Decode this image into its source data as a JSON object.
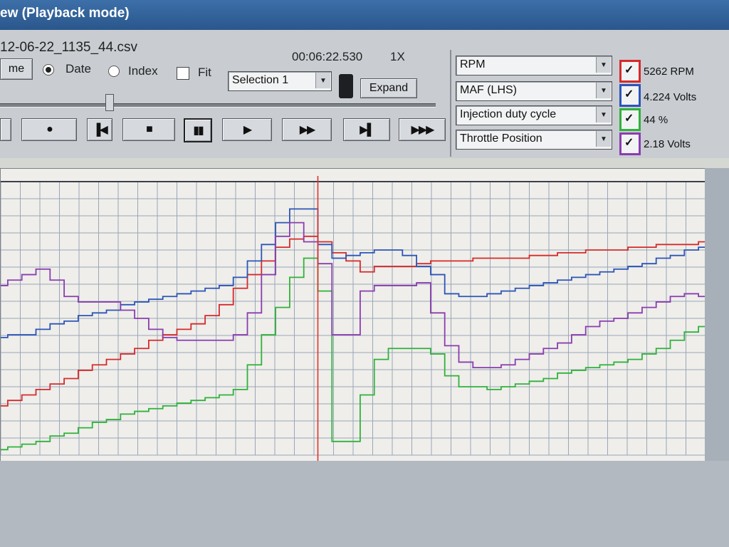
{
  "window": {
    "title": "ew (Playback mode)"
  },
  "toolbar": {
    "filename": "12-06-22_1135_44.csv",
    "timecode": "00:06:22.530",
    "speed": "1X",
    "time_button_label": "me",
    "radio_date_label": "Date",
    "radio_index_label": "Index",
    "fit_label": "Fit",
    "selection_value": "Selection 1",
    "expand_label": "Expand",
    "slider_position": 0.25
  },
  "channels": [
    {
      "param": "RPM",
      "readout": "5262 RPM",
      "color": "#d62a2a",
      "checked": true
    },
    {
      "param": "MAF (LHS)",
      "readout": "4.224 Volts",
      "color": "#2c55b8",
      "checked": true
    },
    {
      "param": "Injection duty cycle",
      "readout": "44 %",
      "color": "#2fb23a",
      "checked": true
    },
    {
      "param": "Throttle Position",
      "readout": "2.18 Volts",
      "color": "#8a3db0",
      "checked": true
    }
  ],
  "playback_icons": [
    "skip-start-icon",
    "record-icon",
    "step-back-icon",
    "stop-icon",
    "pause-icon",
    "play-icon",
    "fast-forward-icon",
    "step-forward-icon",
    "fastest-forward-icon"
  ],
  "chart_data": {
    "type": "line",
    "x": [
      0,
      2,
      4,
      6,
      8,
      10,
      12,
      14,
      16,
      18,
      20,
      22,
      24,
      26,
      28,
      30,
      32,
      34,
      36,
      38,
      40,
      42,
      44,
      46,
      48,
      50,
      52,
      54,
      56,
      58,
      60,
      62,
      64,
      66,
      68,
      70,
      72,
      74,
      76,
      78,
      80,
      82,
      84,
      86,
      88,
      90,
      92,
      94,
      96,
      98,
      100
    ],
    "xlim": [
      0,
      100
    ],
    "ylim": [
      0,
      100
    ],
    "cursor_x": 45,
    "grid": true,
    "series": [
      {
        "color": "#d62a2a",
        "values": [
          18,
          20,
          22,
          24,
          26,
          28,
          31,
          33,
          35,
          37,
          39,
          42,
          44,
          46,
          48,
          51,
          55,
          61,
          66,
          71,
          76,
          79,
          80,
          78,
          74,
          71,
          67,
          69,
          69,
          69,
          70,
          71,
          71,
          71,
          72,
          72,
          72,
          72,
          73,
          73,
          74,
          74,
          75,
          75,
          75,
          76,
          76,
          77,
          77,
          77,
          78
        ]
      },
      {
        "color": "#2c55b8",
        "values": [
          43,
          44,
          44,
          46,
          48,
          49,
          51,
          52,
          53,
          55,
          56,
          57,
          58,
          59,
          60,
          61,
          62,
          65,
          71,
          77,
          85,
          90,
          90,
          77,
          72,
          73,
          74,
          75,
          75,
          73,
          69,
          66,
          59,
          58,
          58,
          59,
          60,
          61,
          62,
          63,
          64,
          65,
          66,
          67,
          68,
          69,
          70,
          72,
          73,
          75,
          76
        ]
      },
      {
        "color": "#2fb23a",
        "values": [
          2,
          3,
          4,
          5,
          7,
          8,
          10,
          12,
          13,
          15,
          16,
          17,
          18,
          19,
          20,
          21,
          22,
          24,
          33,
          44,
          54,
          65,
          72,
          60,
          5,
          5,
          22,
          35,
          39,
          39,
          39,
          37,
          29,
          25,
          25,
          24,
          25,
          26,
          27,
          28,
          30,
          31,
          32,
          33,
          34,
          35,
          37,
          39,
          42,
          45,
          47
        ]
      },
      {
        "color": "#8a3db0",
        "values": [
          62,
          64,
          66,
          68,
          64,
          58,
          56,
          56,
          56,
          53,
          50,
          46,
          43,
          42,
          42,
          42,
          42,
          44,
          52,
          66,
          80,
          85,
          78,
          70,
          44,
          44,
          60,
          62,
          62,
          62,
          63,
          52,
          40,
          34,
          32,
          32,
          33,
          35,
          37,
          39,
          41,
          44,
          47,
          49,
          50,
          52,
          54,
          56,
          58,
          59,
          58
        ]
      }
    ]
  }
}
